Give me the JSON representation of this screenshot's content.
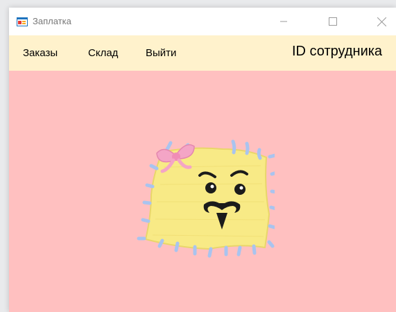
{
  "window": {
    "title": "Заплатка"
  },
  "menu": {
    "items": [
      {
        "label": "Заказы"
      },
      {
        "label": "Склад"
      },
      {
        "label": "Выйти"
      }
    ],
    "employee_label": "ID сотрудника"
  },
  "colors": {
    "menubar_bg": "#fff2cc",
    "client_bg": "#ffc0c0",
    "patch_yellow": "#f8ea86",
    "stitch_blue": "#a9c4ef",
    "bow_pink": "#f4a5c6"
  },
  "icons": {
    "app": "form-app-icon",
    "minimize": "minimize-icon",
    "maximize": "maximize-icon",
    "close": "close-icon",
    "mascot": "patch-mascot-image"
  }
}
